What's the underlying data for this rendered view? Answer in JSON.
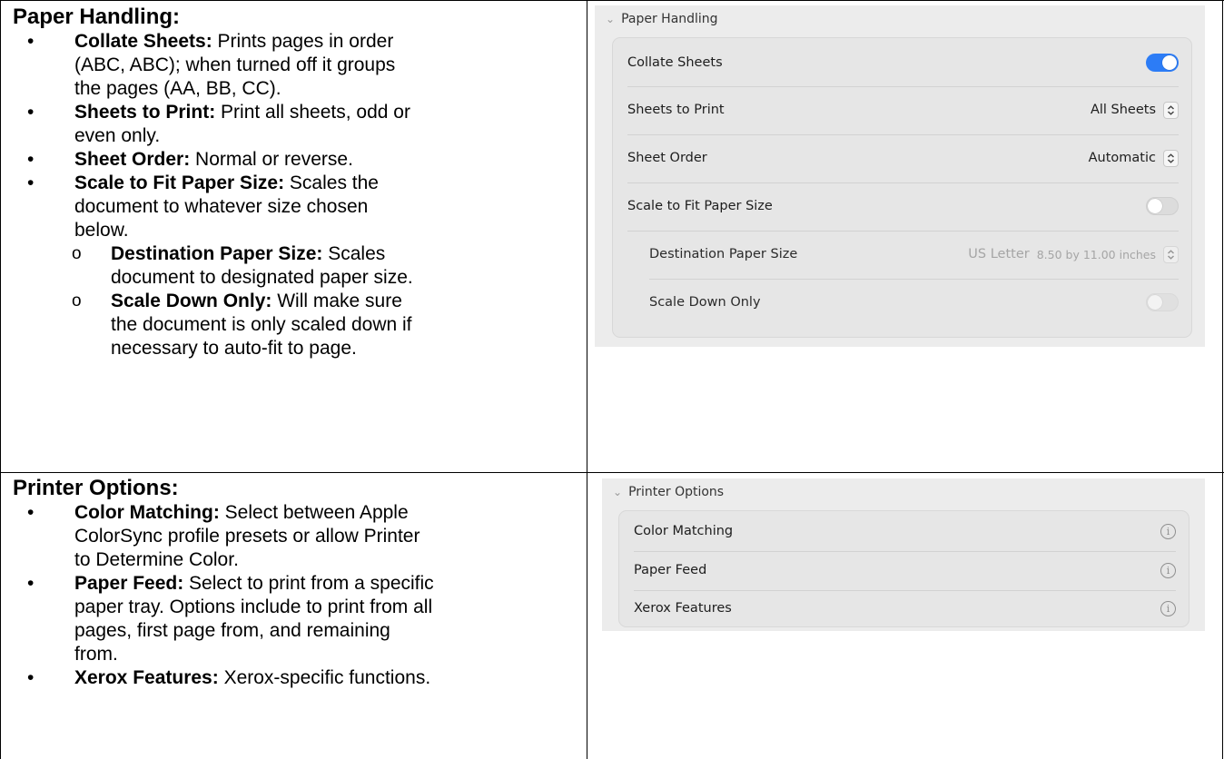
{
  "left": {
    "paper_handling": {
      "title": "Paper Handling:",
      "items": [
        {
          "term": "Collate Sheets:",
          "lines": [
            " Prints pages in order",
            "(ABC, ABC); when turned off it groups",
            "the pages (AA, BB, CC)."
          ]
        },
        {
          "term": "Sheets to Print:",
          "lines": [
            " Print all sheets, odd or",
            "even only."
          ]
        },
        {
          "term": "Sheet Order:",
          "lines": [
            " Normal or reverse."
          ]
        },
        {
          "term": "Scale to Fit Paper Size:",
          "lines": [
            " Scales the",
            "document to whatever size chosen",
            "below."
          ]
        }
      ],
      "subitems": [
        {
          "term": "Destination Paper Size:",
          "lines": [
            " Scales",
            "document to designated paper size."
          ]
        },
        {
          "term": "Scale Down Only:",
          "lines": [
            " Will make sure",
            "the document is only scaled down if",
            "necessary to auto-fit to page."
          ]
        }
      ]
    },
    "printer_options": {
      "title": "Printer Options:",
      "items": [
        {
          "term": "Color Matching:",
          "lines": [
            " Select between Apple",
            "ColorSync profile presets or allow Printer",
            "to Determine Color."
          ]
        },
        {
          "term": "Paper Feed:",
          "lines": [
            " Select to print from a specific",
            "paper tray. Options include to print from all",
            "pages, first page from, and remaining",
            "from."
          ]
        },
        {
          "term": "Xerox Features:",
          "lines": [
            " Xerox-specific functions."
          ]
        }
      ]
    },
    "bullet_glyph": "•",
    "sub_bullet_glyph": "o"
  },
  "panel1": {
    "header": "Paper Handling",
    "rows": {
      "collate": {
        "label": "Collate Sheets",
        "toggle": "on"
      },
      "sheets_to_print": {
        "label": "Sheets to Print",
        "value": "All Sheets"
      },
      "sheet_order": {
        "label": "Sheet Order",
        "value": "Automatic"
      },
      "scale_to_fit": {
        "label": "Scale to Fit Paper Size",
        "toggle": "off"
      },
      "destination": {
        "label": "Destination Paper Size",
        "value": "US Letter",
        "detail": "8.50 by 11.00 inches"
      },
      "scale_down": {
        "label": "Scale Down Only",
        "toggle": "off"
      }
    }
  },
  "panel2": {
    "header": "Printer Options",
    "rows": {
      "color_matching": {
        "label": "Color Matching"
      },
      "paper_feed": {
        "label": "Paper Feed"
      },
      "xerox_features": {
        "label": "Xerox Features"
      }
    }
  },
  "colors": {
    "accent": "#2c7cf6",
    "panel_bg": "#ececec",
    "group_bg": "#e6e6e6"
  }
}
